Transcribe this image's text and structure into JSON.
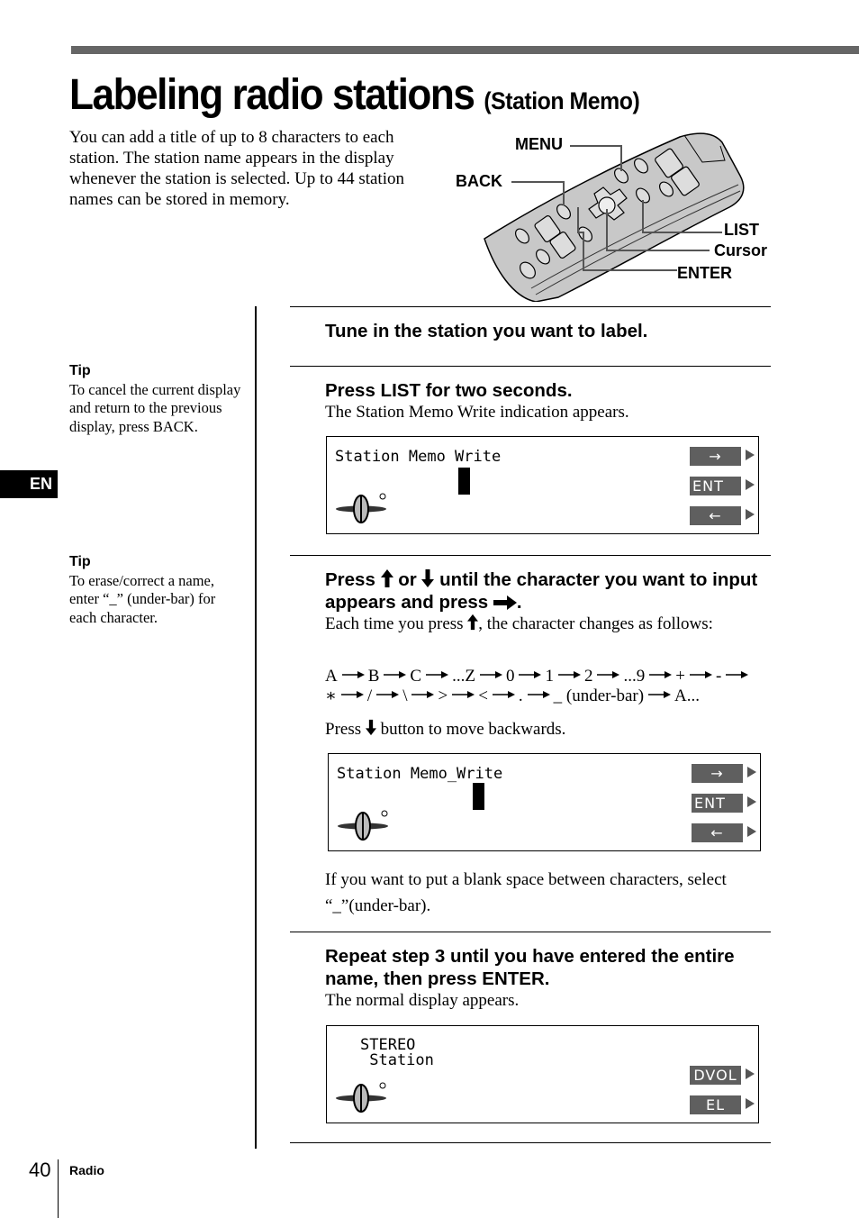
{
  "header": {
    "title": "Labeling radio stations",
    "subtitle": "(Station Memo)"
  },
  "intro": "You can add a title of up to 8 characters to each station.  The station name appears in the display whenever the station is selected.  Up to 44 station names can be stored in memory.",
  "remote_labels": {
    "menu": "MENU",
    "back": "BACK",
    "list": "LIST",
    "cursor": "Cursor",
    "enter": "ENTER"
  },
  "tips": [
    {
      "heading": "Tip",
      "text": "To cancel the current display and return to the previous display, press BACK."
    },
    {
      "heading": "Tip",
      "text": "To erase/correct a name, enter “_” (under-bar) for each character."
    }
  ],
  "language_tab": "EN",
  "steps": [
    {
      "heading": "Tune in the station you want to label."
    },
    {
      "heading": "Press LIST for two seconds.",
      "body": "The Station Memo Write indication appears."
    },
    {
      "heading_parts": [
        "Press ",
        " or ",
        " until the character you want to input appears and press ",
        "."
      ],
      "body_parts": [
        "Each time you press ",
        ", the character changes as follows:"
      ],
      "sequence_line1": [
        "A",
        "B",
        "C",
        "...Z",
        "0",
        "1",
        "2",
        "...9",
        "+",
        "-",
        ""
      ],
      "sequence_line2": [
        "∗",
        "/",
        "\\",
        ">",
        "<",
        ".",
        "_ (under-bar)",
        "A..."
      ],
      "backwards_parts": [
        "Press ",
        " button to move backwards."
      ],
      "note": "If you want to put a blank space between characters, select “_”(under-bar)."
    },
    {
      "heading": "Repeat step 3 until you have entered the entire name, then press ENTER.",
      "body": "The normal display appears."
    }
  ],
  "displays": {
    "write1": {
      "text": "Station Memo Write",
      "buttons": [
        "→",
        "ENT",
        "←"
      ]
    },
    "write2": {
      "text": "Station Memo_Write",
      "buttons": [
        "→",
        "ENT",
        "←"
      ]
    },
    "normal": {
      "line1": "STEREO",
      "line2": " Station",
      "buttons": [
        "DVOL",
        "EL"
      ]
    }
  },
  "footer": {
    "page_number": "40",
    "section": "Radio"
  }
}
